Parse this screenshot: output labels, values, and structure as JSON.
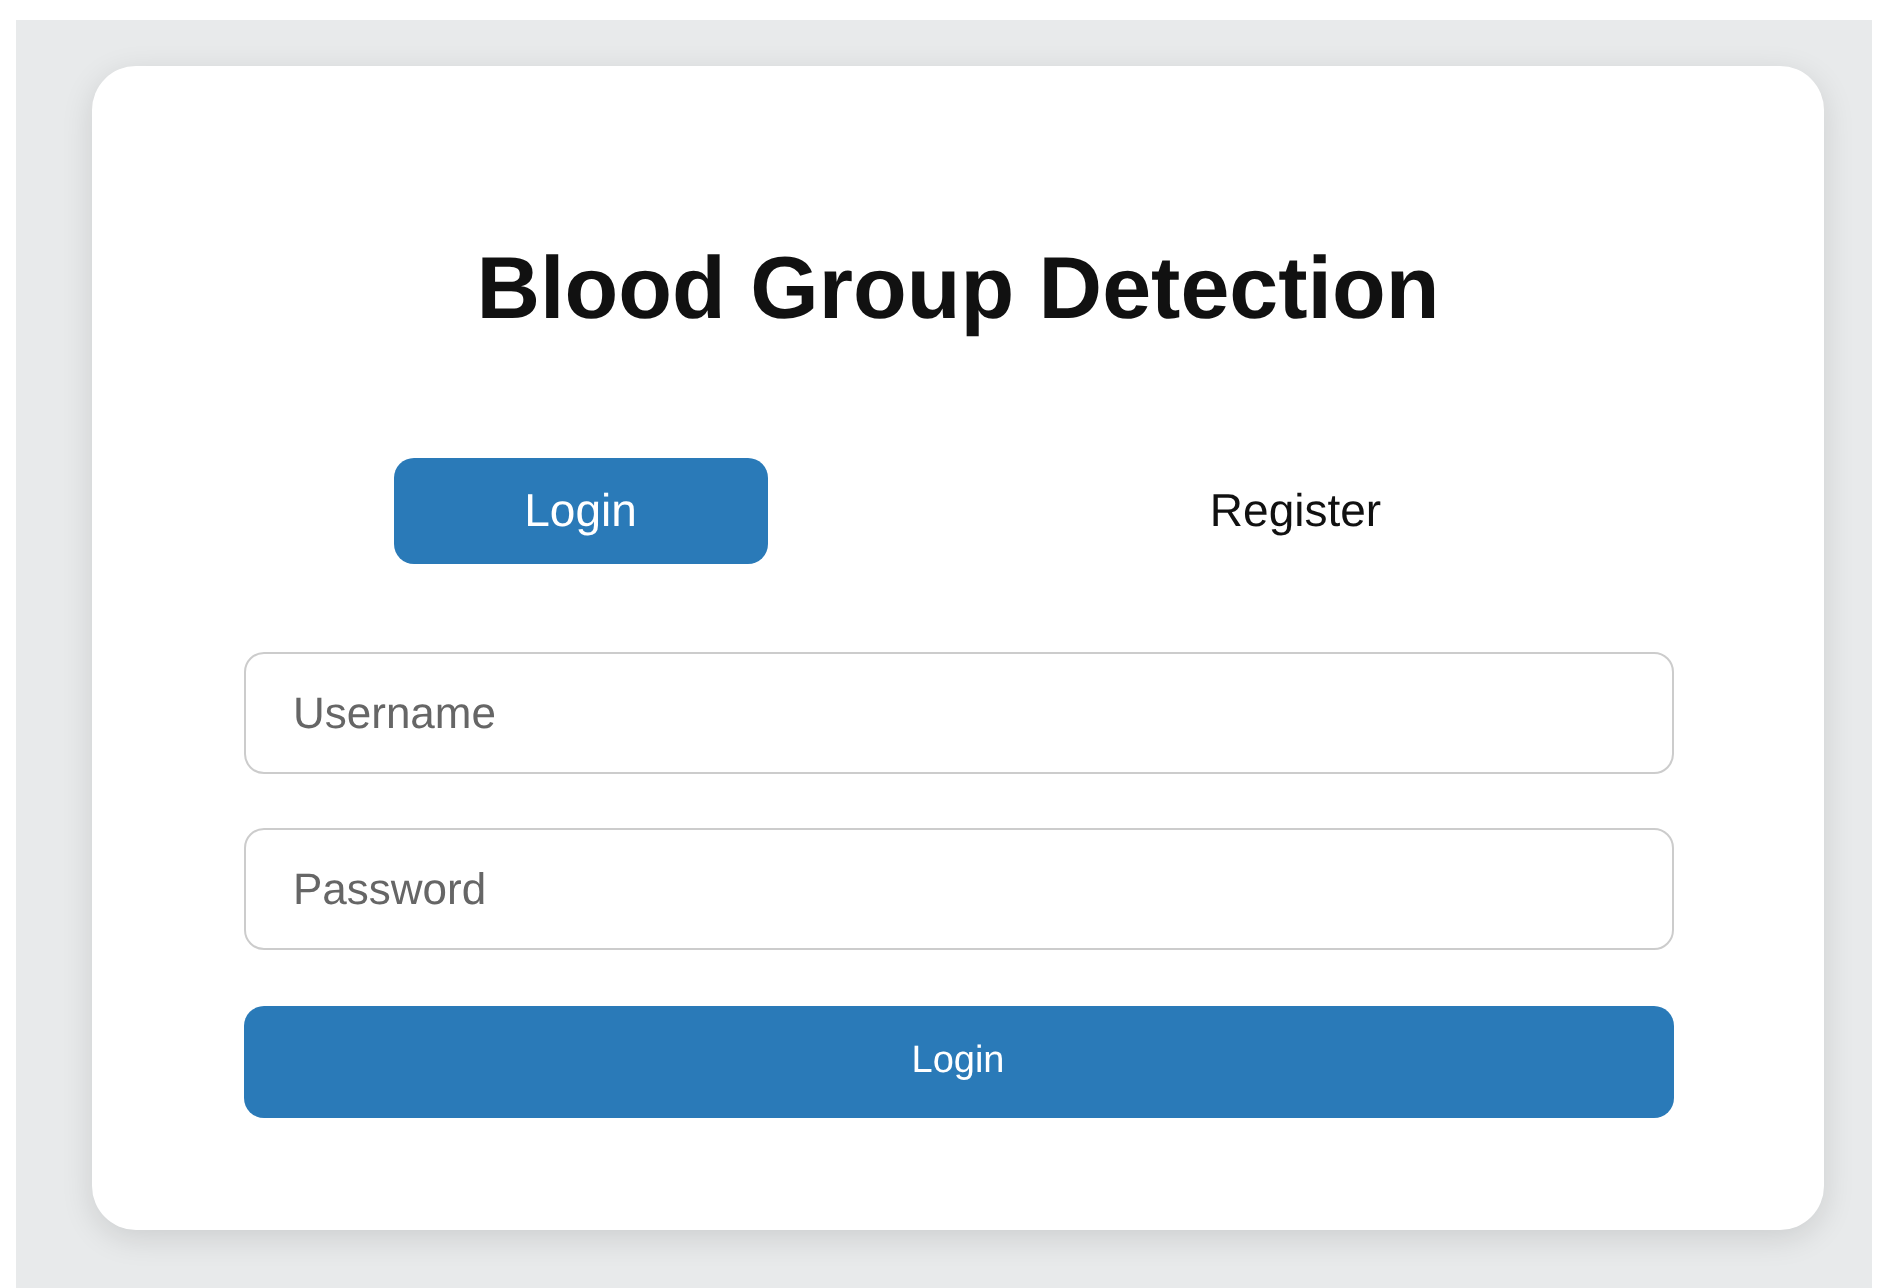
{
  "title": "Blood Group Detection",
  "tabs": [
    {
      "label": "Login",
      "selected": true
    },
    {
      "label": "Register",
      "selected": false
    }
  ],
  "fields": [
    {
      "placeholder": "Username"
    },
    {
      "placeholder": "Password"
    }
  ],
  "submit": {
    "label": "Login"
  }
}
